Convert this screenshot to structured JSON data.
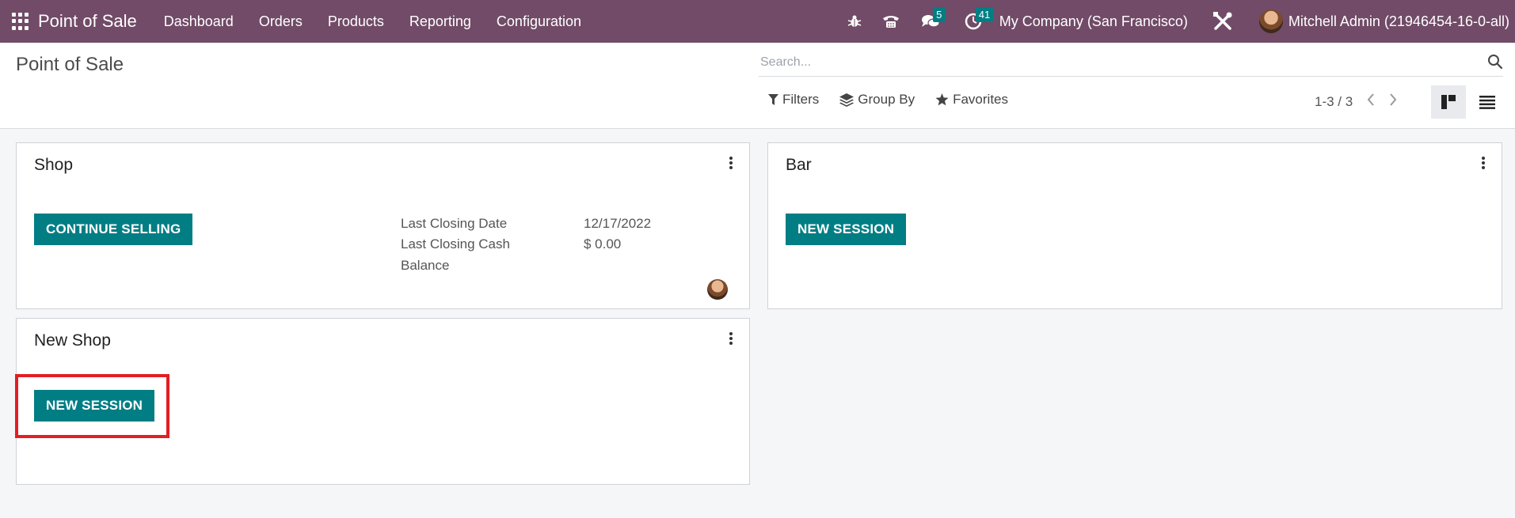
{
  "navbar": {
    "app_title": "Point of Sale",
    "menu": [
      "Dashboard",
      "Orders",
      "Products",
      "Reporting",
      "Configuration"
    ],
    "messages_count": "5",
    "activities_count": "41",
    "company": "My Company (San Francisco)",
    "user": "Mitchell Admin (21946454-16-0-all)",
    "accent_color": "#714b67",
    "badge_color": "#017e84"
  },
  "control_panel": {
    "title": "Point of Sale",
    "search_placeholder": "Search...",
    "filters_label": "Filters",
    "group_by_label": "Group By",
    "favorites_label": "Favorites",
    "pager": "1-3 / 3"
  },
  "cards": {
    "shop": {
      "title": "Shop",
      "button": "CONTINUE SELLING",
      "last_closing_date_label": "Last Closing Date",
      "last_closing_date": "12/17/2022",
      "last_closing_cash_label": "Last Closing Cash",
      "last_closing_cash_label_2": "Balance",
      "last_closing_cash": "$ 0.00"
    },
    "bar": {
      "title": "Bar",
      "button": "NEW SESSION"
    },
    "new_shop": {
      "title": "New Shop",
      "button": "NEW SESSION"
    }
  },
  "primary_color": "#017e84",
  "highlight_color": "#e31e24"
}
